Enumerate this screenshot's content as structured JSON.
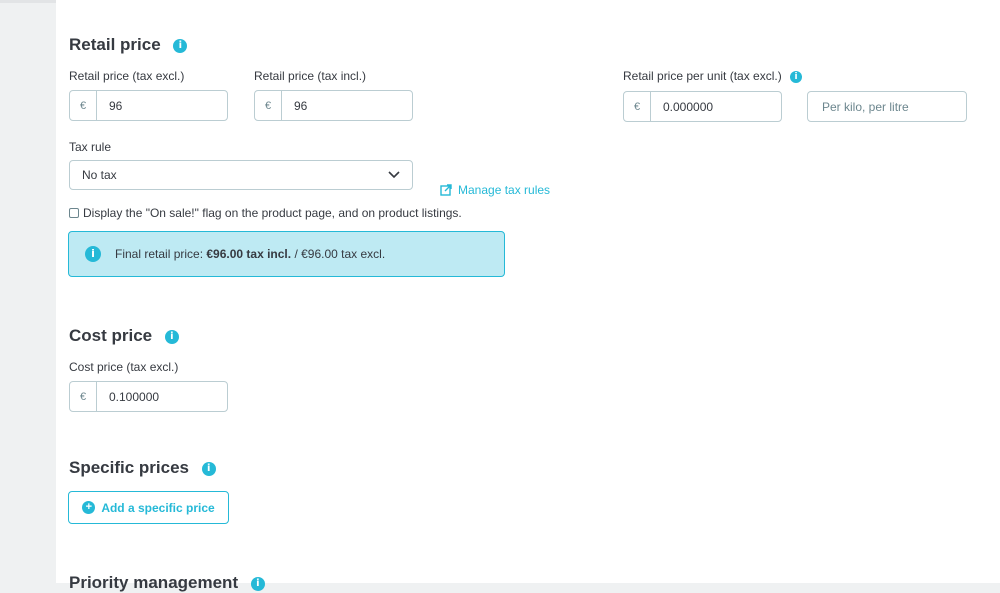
{
  "colors": {
    "accent": "#25b9d7",
    "alert_bg": "#beeaf3",
    "text": "#363a41",
    "border": "#bbcdd2"
  },
  "retail": {
    "title": "Retail price",
    "info_icon": "info-icon",
    "tax_excl_label": "Retail price (tax excl.)",
    "tax_excl_currency": "€",
    "tax_excl_value": "96",
    "tax_incl_label": "Retail price (tax incl.)",
    "tax_incl_currency": "€",
    "tax_incl_value": "96",
    "per_unit_label": "Retail price per unit (tax excl.)",
    "per_unit_currency": "€",
    "per_unit_value": "0.000000",
    "unit_placeholder": "Per kilo, per litre",
    "tax_rule_label": "Tax rule",
    "tax_rule_value": "No tax",
    "manage_tax_rules": "Manage tax rules",
    "on_sale_label": "Display the \"On sale!\" flag on the product page, and on product listings.",
    "final_prefix": "Final retail price: ",
    "final_incl": "€96.00 tax incl.",
    "final_suffix": " / €96.00 tax excl."
  },
  "cost": {
    "title": "Cost price",
    "field_label": "Cost price (tax excl.)",
    "currency": "€",
    "value": "0.100000"
  },
  "specific": {
    "title": "Specific prices",
    "add_button": "Add a specific price"
  },
  "priority": {
    "title": "Priority management"
  }
}
